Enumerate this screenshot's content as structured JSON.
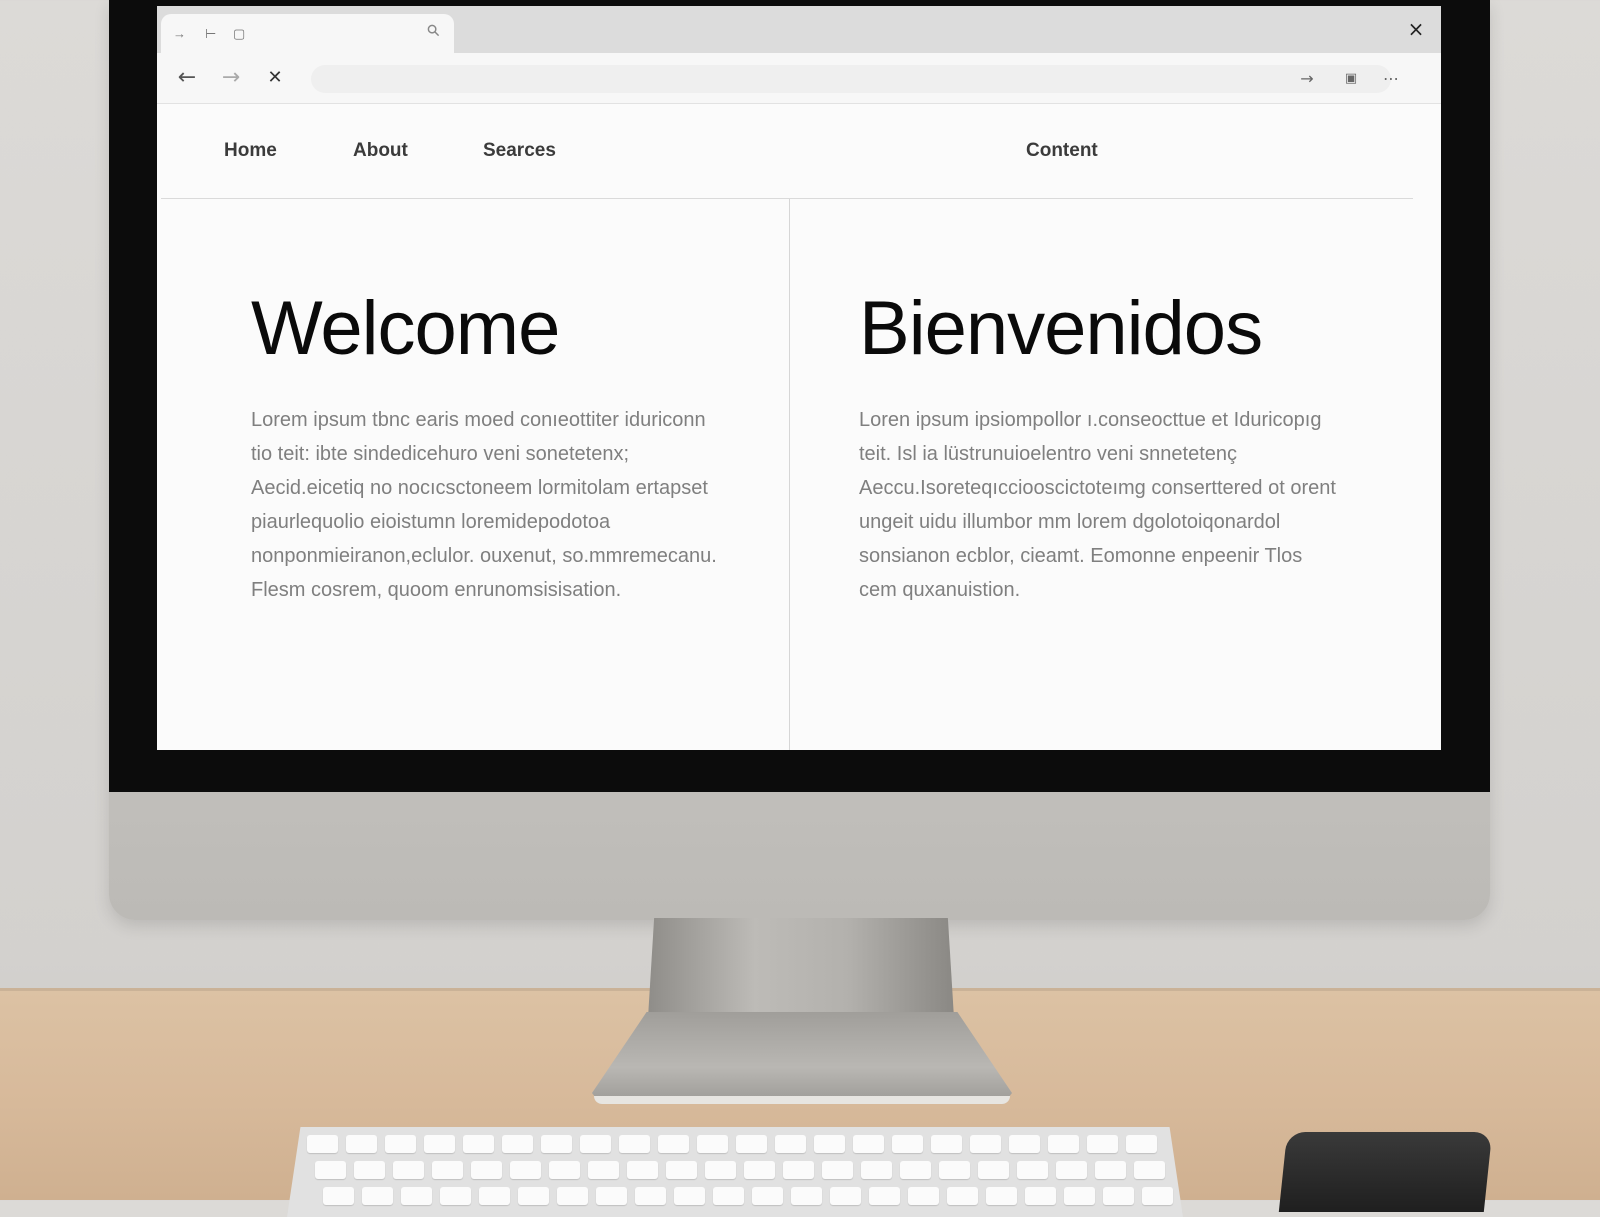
{
  "browser": {
    "tab_glyphs": [
      "→",
      "⊢",
      "▢"
    ],
    "window_close": "×",
    "toolbar": {
      "back_icon": "←",
      "forward_icon": "→",
      "stop_icon": "✕",
      "address_value": "",
      "address_right_icons": [
        "→",
        "▣",
        "⋯"
      ]
    }
  },
  "site": {
    "nav": [
      "Home",
      "About",
      "Searces",
      "Content"
    ],
    "left": {
      "heading": "Welcome",
      "body": "Lorem ipsum tbnc earis moed conıeottiter iduriconn tio teit: ibte sindedicehuro veni sonetetenx; Aecid.eicetiq no nocıcsctoneem lormitolam ertapset piaurlequolio eioistumn loremidepodotoa nonponmieiranon,eclulor. ouxenut, so.mmremecanu. Flesm cosrem, quoom enrunomsisisation."
    },
    "right": {
      "heading": "Bienvenidos",
      "body": "Loren ipsum ipsiompollor ı.conseocttue et Iduricopıg teit. Isl ia lüstrunuioelentro veni snnetetenç Aeccu.Isoreteqıcciooscictoteımg conserttered ot orent ungeit uidu illumbor mm lorem dgolotoiqonardol sonsianon ecblor, cieamt. Eomonne enpeenir Tlos cem quxanuistion."
    }
  },
  "colors": {
    "screen_bg": "#fbfbfb",
    "heading": "#0a0a0a",
    "body_text": "#7f7f7f",
    "bezel": "#0c0c0c"
  }
}
